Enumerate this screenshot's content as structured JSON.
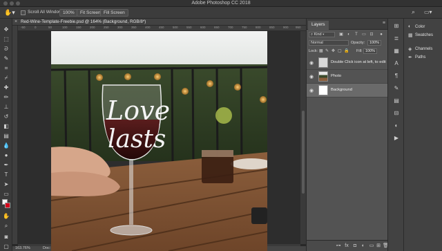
{
  "window": {
    "title": "Adobe Photoshop CC 2018"
  },
  "options_bar": {
    "scroll_all_windows": "Scroll All Windows",
    "buttons": [
      "100%",
      "Fit Screen",
      "Fill Screen"
    ]
  },
  "document": {
    "tab_title": "Red-Wine-Template-Freebie.psd @ 164% (Background, RGB/8*)",
    "ruler_ticks": [
      "-50",
      "0",
      "50",
      "100",
      "150",
      "200",
      "250",
      "300",
      "350",
      "400",
      "450",
      "500",
      "550",
      "600",
      "650",
      "700",
      "750",
      "800",
      "850",
      "900",
      "950"
    ],
    "zoom": "163.76%",
    "doc_size": "Doc: 2.13M/8.48M"
  },
  "photo": {
    "glass_text_line1": "Love",
    "glass_text_line2": "lasts"
  },
  "layers_panel": {
    "tab": "Layers",
    "kind": "Kind",
    "blend_mode": "Normal",
    "opacity_label": "Opacity:",
    "opacity_value": "100%",
    "lock_label": "Lock:",
    "fill_label": "Fill:",
    "fill_value": "100%",
    "layers": [
      {
        "name": "Double Click icon at left, to edit"
      },
      {
        "name": "Photo"
      },
      {
        "name": "Background"
      }
    ]
  },
  "right_panel": {
    "items": [
      "Color",
      "Swatches",
      "Channels",
      "Paths"
    ]
  },
  "colors": {
    "foreground": "#f4f4f4",
    "background": "#d4001a",
    "selected_layer": "#6a6a6a"
  }
}
